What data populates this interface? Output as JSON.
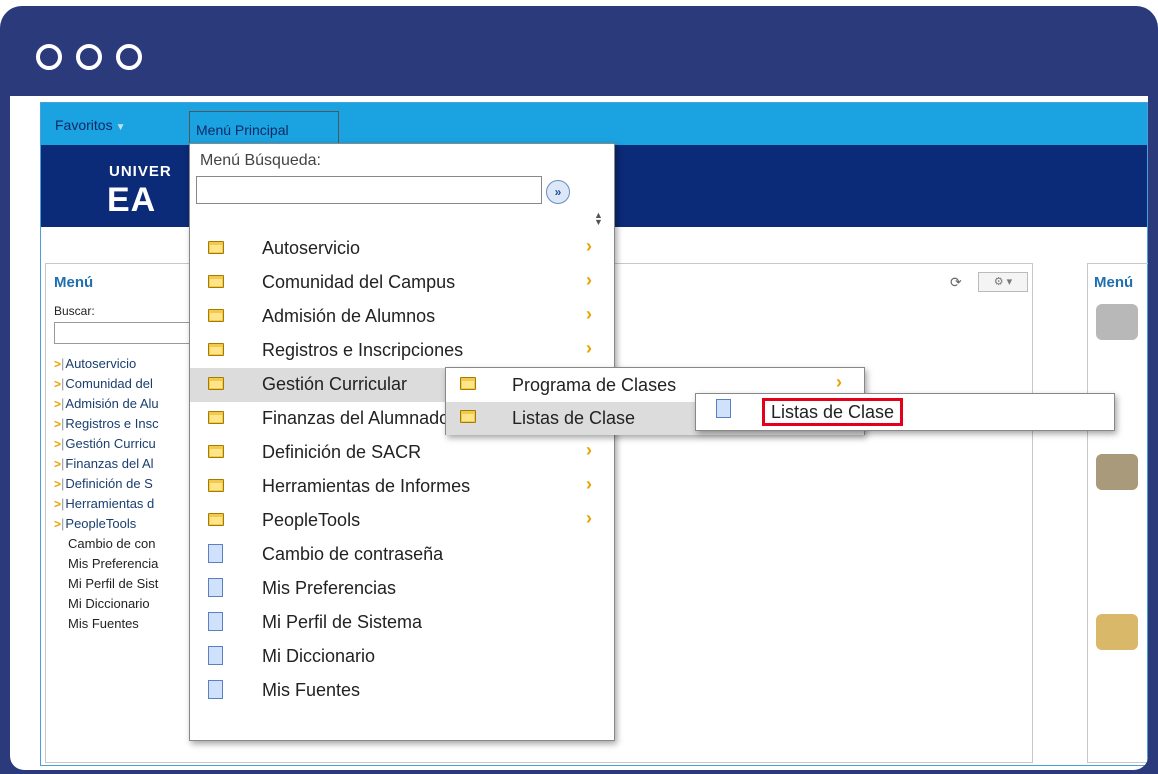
{
  "colors": {
    "frame": "#2b3a7a",
    "navbar": "#1aa3e0",
    "banner": "#0b2a78",
    "highlight": "#e2001a",
    "chevron": "#e8a200"
  },
  "navbar": {
    "favorites_label": "Favoritos",
    "main_menu_label": "Menú Principal"
  },
  "banner": {
    "univ_text": "UNIVER",
    "eafit_text": "EA"
  },
  "menu_panel": {
    "title": "Menú",
    "search_label": "Buscar:",
    "folder_items": [
      "Autoservicio",
      "Comunidad del",
      "Admisión de Alu",
      "Registros e Insc",
      "Gestión Curricu",
      "Finanzas del Al",
      "Definición de S",
      "Herramientas d",
      "PeopleTools"
    ],
    "page_items": [
      "Cambio de con",
      "Mis Preferencia",
      "Mi Perfil de Sist",
      "Mi Diccionario",
      "Mis Fuentes"
    ]
  },
  "right_panel": {
    "title": "Menú"
  },
  "dropdown": {
    "title": "Menú Búsqueda:",
    "search_value": "",
    "go_icon": "double-chevron-right-icon",
    "items": [
      {
        "label": "Autoservicio",
        "icon": "folder-icon",
        "has_submenu": true
      },
      {
        "label": "Comunidad del Campus",
        "icon": "folder-icon",
        "has_submenu": true
      },
      {
        "label": "Admisión de Alumnos",
        "icon": "folder-icon",
        "has_submenu": true
      },
      {
        "label": "Registros e Inscripciones",
        "icon": "folder-icon",
        "has_submenu": true
      },
      {
        "label": "Gestión Curricular",
        "icon": "folder-icon",
        "has_submenu": true,
        "active": true
      },
      {
        "label": "Finanzas del Alumnado",
        "icon": "folder-icon",
        "has_submenu": true
      },
      {
        "label": "Definición de SACR",
        "icon": "folder-icon",
        "has_submenu": true
      },
      {
        "label": "Herramientas de Informes",
        "icon": "folder-icon",
        "has_submenu": true
      },
      {
        "label": "PeopleTools",
        "icon": "folder-icon",
        "has_submenu": true
      },
      {
        "label": "Cambio de contraseña",
        "icon": "document-icon",
        "has_submenu": false
      },
      {
        "label": "Mis Preferencias",
        "icon": "document-icon",
        "has_submenu": false
      },
      {
        "label": "Mi Perfil de Sistema",
        "icon": "document-icon",
        "has_submenu": false
      },
      {
        "label": "Mi Diccionario",
        "icon": "document-icon",
        "has_submenu": false
      },
      {
        "label": "Mis Fuentes",
        "icon": "document-icon",
        "has_submenu": false
      }
    ]
  },
  "submenu_curricular": {
    "items": [
      {
        "label": "Programa de Clases",
        "icon": "folder-icon",
        "has_submenu": true
      },
      {
        "label": "Listas de Clase",
        "icon": "folder-icon",
        "has_submenu": true,
        "active": true
      }
    ]
  },
  "submenu_listas": {
    "item_label": "Listas de Clase",
    "icon": "document-icon"
  }
}
